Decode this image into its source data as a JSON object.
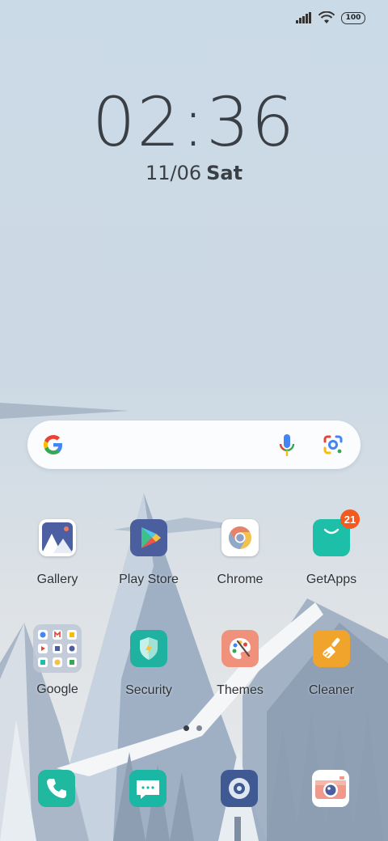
{
  "status_bar": {
    "battery": "100",
    "icons": [
      "signal-icon",
      "wifi-icon",
      "battery-icon"
    ]
  },
  "clock": {
    "time": "02:36",
    "date": "11/06",
    "day": "Sat"
  },
  "search_bar": {
    "icons": [
      "google-g-icon",
      "mic-icon",
      "lens-icon"
    ]
  },
  "apps": {
    "row1": [
      {
        "label": "Gallery"
      },
      {
        "label": "Play Store"
      },
      {
        "label": "Chrome"
      },
      {
        "label": "GetApps",
        "badge": "21"
      }
    ],
    "row2": [
      {
        "label": "Google"
      },
      {
        "label": "Security"
      },
      {
        "label": "Themes"
      },
      {
        "label": "Cleaner"
      }
    ]
  },
  "pager": {
    "pages": 2,
    "current": 1
  },
  "dock": {
    "icons": [
      "phone-icon",
      "messages-icon",
      "music-icon",
      "camera-icon"
    ]
  },
  "colors": {
    "badge": "#f25a1f",
    "sky": "#c9d8e6"
  }
}
